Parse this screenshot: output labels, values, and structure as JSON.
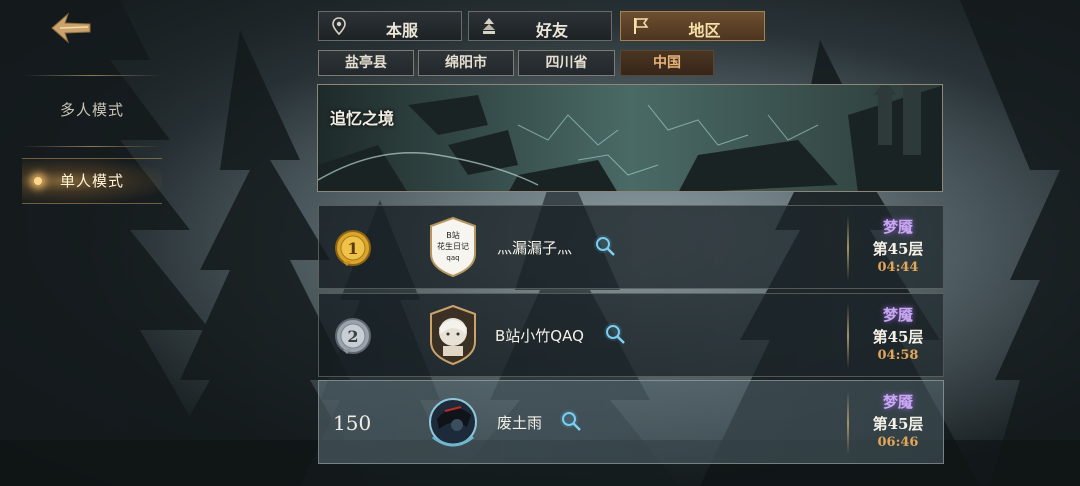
{
  "sidebar": {
    "modes": [
      {
        "label": "多人模式"
      },
      {
        "label": "单人模式"
      }
    ]
  },
  "tabs": [
    {
      "label": "本服",
      "icon": "location-pin-icon"
    },
    {
      "label": "好友",
      "icon": "friends-icon"
    },
    {
      "label": "地区",
      "icon": "flag-icon"
    }
  ],
  "active_tab": "地区",
  "region_tabs": [
    "盐亭县",
    "绵阳市",
    "四川省",
    "中国"
  ],
  "active_region": "中国",
  "banner": {
    "title": "追忆之境"
  },
  "rankings": [
    {
      "rank": "1",
      "avatar_text": [
        "B站",
        "花生日记",
        "qaq"
      ],
      "name": "灬漏漏子灬",
      "difficulty": "梦魇",
      "floor": "第45层",
      "time": "04:44"
    },
    {
      "rank": "2",
      "name": "B站小竹QAQ",
      "difficulty": "梦魇",
      "floor": "第45层",
      "time": "04:58"
    },
    {
      "rank": "150",
      "name": "废土雨",
      "difficulty": "梦魇",
      "floor": "第45层",
      "time": "06:46"
    }
  ],
  "colors": {
    "accent_gold": "#c9a36b",
    "active_tab_bg": "#6d4f30",
    "difficulty_purple": "#c8a8f0",
    "time_orange": "#e2a65a"
  }
}
